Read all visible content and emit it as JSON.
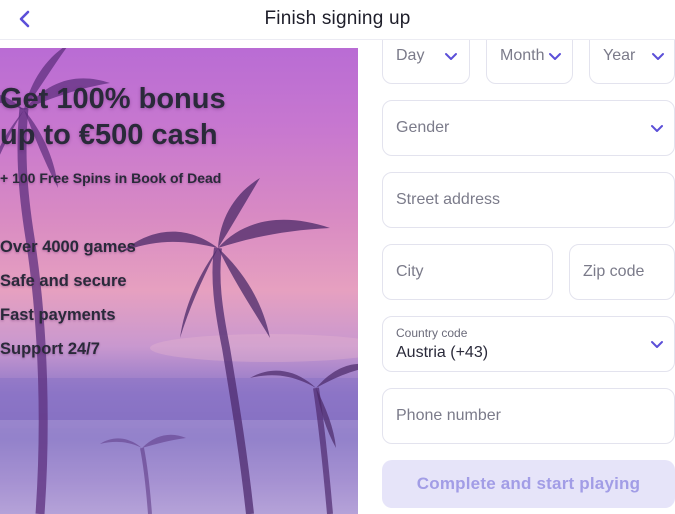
{
  "header": {
    "title": "Finish signing up",
    "back_icon": "chevron-left-icon"
  },
  "promo": {
    "headline_line1": "Get 100% bonus",
    "headline_line2": "up to €500 cash",
    "subline": "+ 100 Free Spins in Book of Dead",
    "features": [
      "Over 4000 games",
      "Safe and secure",
      "Fast payments",
      "Support 24/7"
    ]
  },
  "form": {
    "day": {
      "placeholder": "Day"
    },
    "month": {
      "placeholder": "Month"
    },
    "year": {
      "placeholder": "Year"
    },
    "gender": {
      "placeholder": "Gender"
    },
    "street": {
      "placeholder": "Street address"
    },
    "city": {
      "placeholder": "City"
    },
    "zip": {
      "placeholder": "Zip code"
    },
    "country": {
      "label": "Country code",
      "value": "Austria (+43)"
    },
    "phone": {
      "placeholder": "Phone number"
    },
    "submit_label": "Complete and start playing"
  },
  "colors": {
    "accent": "#5b4fd8",
    "submit_bg": "#e6e4f9",
    "submit_text": "#a29de6",
    "field_border": "#e3e3ee"
  }
}
